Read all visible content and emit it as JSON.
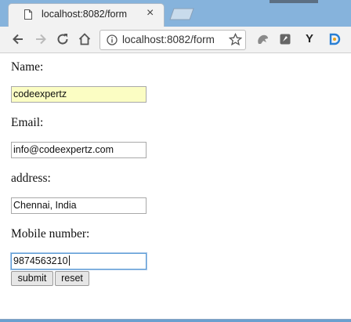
{
  "browser": {
    "tab_title": "localhost:8082/form",
    "tab_close": "×",
    "url": "localhost:8082/form",
    "extension_y_label": "Y",
    "icons": [
      "back-icon",
      "forward-icon",
      "reload-icon",
      "home-icon",
      "info-icon",
      "star-icon",
      "extension-icon"
    ]
  },
  "form": {
    "name_label": "Name:",
    "name_value": "codeexpertz",
    "email_label": "Email:",
    "email_value": "info@codeexpertz.com",
    "address_label": "address:",
    "address_value": "Chennai, India",
    "mobile_label": "Mobile number:",
    "mobile_value": "9874563210",
    "submit_label": "submit",
    "reset_label": "reset"
  },
  "colors": {
    "titlebar": "#86b3dc",
    "autofill": "#fbfdc3",
    "focus_border": "#5b9bd5"
  }
}
